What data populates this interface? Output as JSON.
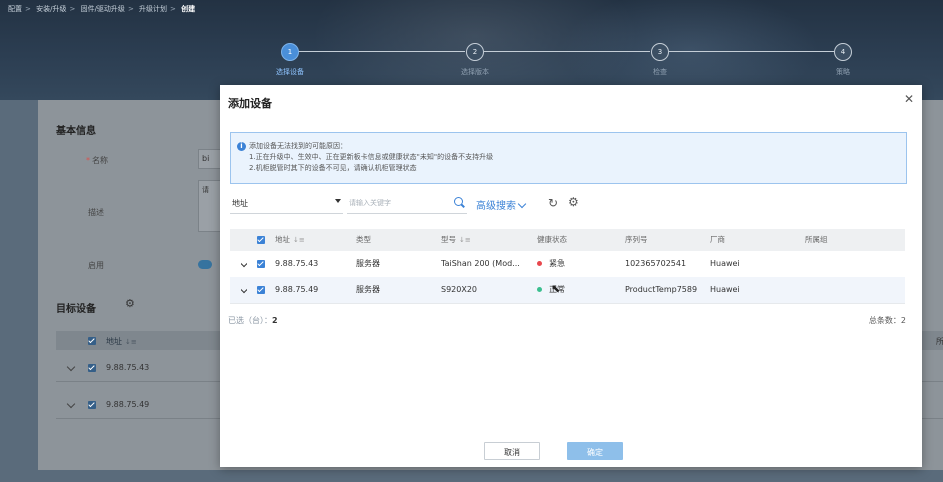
{
  "breadcrumb": [
    "配置",
    "安装/升级",
    "固件/驱动升级",
    "升级计划",
    "创建"
  ],
  "steps": [
    {
      "num": "1",
      "label": "选择设备"
    },
    {
      "num": "2",
      "label": "选择版本"
    },
    {
      "num": "3",
      "label": "检查"
    },
    {
      "num": "4",
      "label": "策略"
    }
  ],
  "bg_form": {
    "basic_info_title": "基本信息",
    "name_label": "名称",
    "name_value": "bi",
    "desc_label": "描述",
    "desc_value": "请",
    "enable_label": "启用",
    "target_title": "目标设备",
    "table_header_addr": "地址",
    "header_right_stub": "所",
    "rows": [
      "9.88.75.43",
      "9.88.75.49"
    ]
  },
  "modal": {
    "title": "添加设备",
    "info_lines": [
      "添加设备无法找到的可能原因：",
      "1.正在升级中、生效中、正在更新板卡信息或健康状态\"未知\"的设备不支持升级",
      "2.机柜脱管时其下的设备不可见，请确认机柜管理状态"
    ],
    "search_field_value": "地址",
    "keyword_placeholder": "请输入关键字",
    "advanced_search_label": "高级搜索",
    "columns": [
      "地址",
      "类型",
      "型号",
      "健康状态",
      "序列号",
      "厂商",
      "所属组"
    ],
    "rows": [
      {
        "address": "9.88.75.43",
        "type": "服务器",
        "model": "TaiShan 200 (Mod...",
        "health": "紧急",
        "health_color": "#e8474d",
        "serial": "102365702541",
        "vendor": "Huawei",
        "group": ""
      },
      {
        "address": "9.88.75.49",
        "type": "服务器",
        "model": "S920X20",
        "health": "正常",
        "health_color": "#3bbf8f",
        "serial": "ProductTemp7589",
        "vendor": "Huawei",
        "group": ""
      }
    ],
    "selected_label": "已选（台）：",
    "selected_value": "2",
    "total_label": "总条数：",
    "total_value": "2",
    "cancel_label": "取消",
    "ok_label": "确定"
  }
}
